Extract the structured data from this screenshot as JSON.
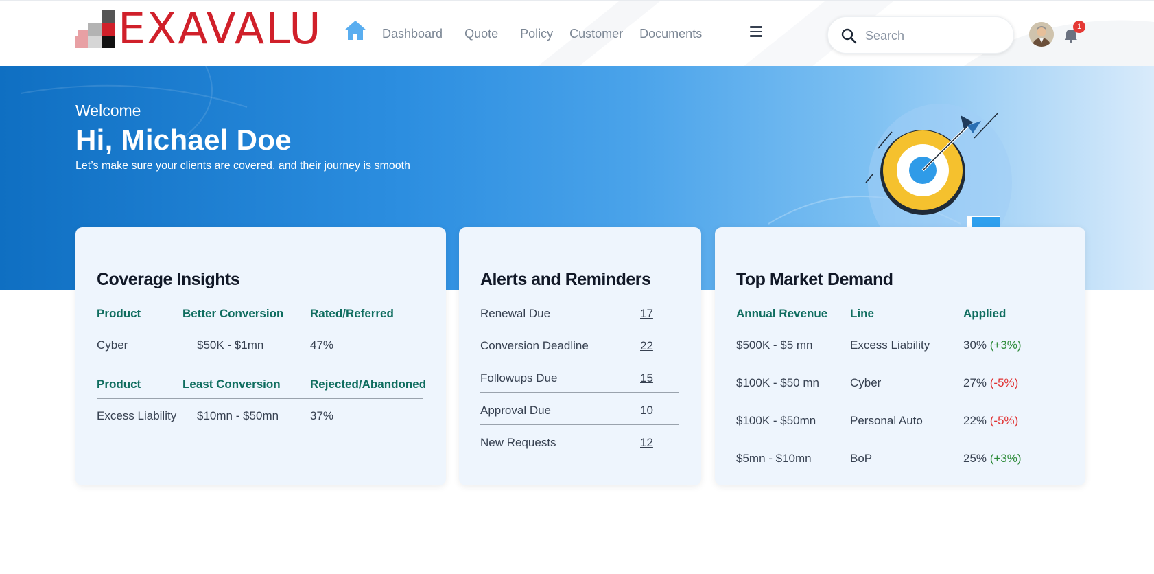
{
  "brand": {
    "name": "EXAVALU",
    "color": "#d0202a"
  },
  "nav": {
    "home_icon": "home-icon",
    "items": [
      "Dashboard",
      "Quote",
      "Policy",
      "Customer",
      "Documents"
    ],
    "menu_icon": "hamburger-menu-icon"
  },
  "search": {
    "placeholder": "Search",
    "icon": "search-icon"
  },
  "user": {
    "avatar_icon": "avatar-icon",
    "notifications_icon": "bell-icon",
    "notification_count": "1"
  },
  "hero": {
    "welcome": "Welcome",
    "greeting": "Hi, Michael Doe",
    "subtitle": "Let’s make sure your clients are covered, and their journey is smooth",
    "illustration_icon": "target-chart-illustration"
  },
  "coverage": {
    "title": "Coverage Insights",
    "best": {
      "headers": [
        "Product",
        "Better Conversion",
        "Rated/Referred"
      ],
      "row": [
        "Cyber",
        "$50K - $1mn",
        "47%"
      ]
    },
    "least": {
      "headers": [
        "Product",
        "Least Conversion",
        "Rejected/Abandoned"
      ],
      "row": [
        "Excess Liability",
        "$10mn - $50mn",
        "37%"
      ]
    }
  },
  "alerts": {
    "title": "Alerts and Reminders",
    "items": [
      {
        "label": "Renewal Due",
        "count": "17"
      },
      {
        "label": "Conversion Deadline",
        "count": "22"
      },
      {
        "label": "Followups Due",
        "count": "15"
      },
      {
        "label": "Approval Due",
        "count": "10"
      },
      {
        "label": "New Requests",
        "count": "12"
      }
    ]
  },
  "market": {
    "title": "Top Market Demand",
    "headers": [
      "Annual Revenue",
      "Line",
      "Applied"
    ],
    "rows": [
      {
        "revenue": "$500K - $5 mn",
        "line": "Excess Liability",
        "applied": "30%",
        "change": "(+3%)",
        "trend": "up"
      },
      {
        "revenue": "$100K - $50 mn",
        "line": "Cyber",
        "applied": "27%",
        "change": "(-5%)",
        "trend": "down"
      },
      {
        "revenue": "$100K - $50mn",
        "line": "Personal Auto",
        "applied": "22%",
        "change": "(-5%)",
        "trend": "down"
      },
      {
        "revenue": "$5mn - $10mn",
        "line": "BoP",
        "applied": "25%",
        "change": "(+3%)",
        "trend": "up"
      }
    ]
  },
  "colors": {
    "accent": "#1f7fd6",
    "header_text": "#0f6d5f",
    "positive": "#2e8b3a",
    "negative": "#e03131"
  }
}
